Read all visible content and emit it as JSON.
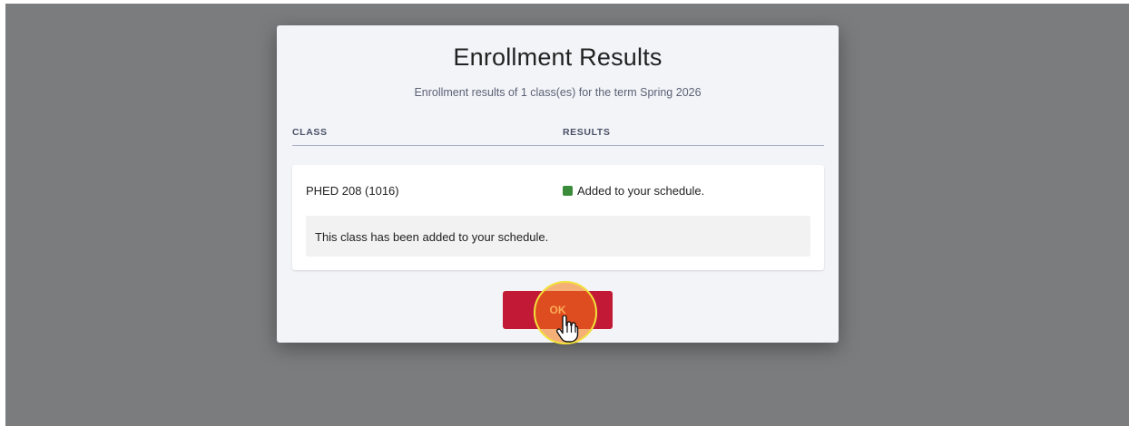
{
  "modal": {
    "title": "Enrollment Results",
    "subtitle": "Enrollment results of 1 class(es) for the term Spring 2026"
  },
  "table": {
    "columns": [
      "CLASS",
      "RESULTS"
    ],
    "rows": [
      {
        "class": "PHED 208 (1016)",
        "result": "Added to your schedule.",
        "result_color": "#3a8b3a",
        "message": "This class has been added to your schedule."
      }
    ]
  },
  "actions": {
    "ok_label": "OK",
    "ok_color": "#c21a36"
  },
  "cursor": {
    "icon": "hand-pointer-icon"
  }
}
